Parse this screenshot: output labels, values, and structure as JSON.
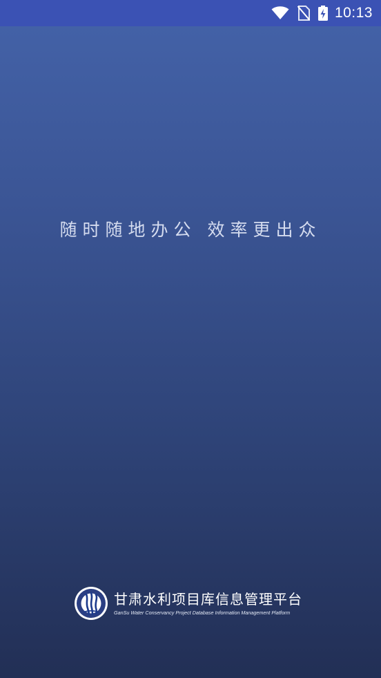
{
  "status_bar": {
    "time": "10:13",
    "icons": [
      "wifi-icon",
      "no-sim-icon",
      "battery-charging-icon"
    ]
  },
  "splash": {
    "slogan": "随时随地办公 效率更出众"
  },
  "brand": {
    "title": "甘肃水利项目库信息管理平台",
    "subtitle": "GanSu Water Conservancy Project Database Information Management Platform",
    "logo_icon": "gansu-water-logo-icon"
  },
  "colors": {
    "status_bar": "#3b52b4",
    "background_top": "#4463a9",
    "background_bottom": "#222f55",
    "slogan_text": "#d5dcef"
  }
}
